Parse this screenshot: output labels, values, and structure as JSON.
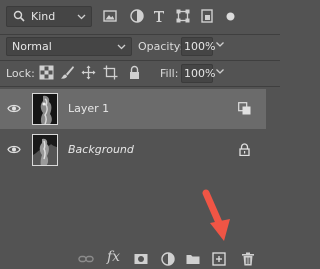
{
  "filter": {
    "kind_label": "Kind",
    "icons": [
      "image-filter-icon",
      "adjustment-filter-icon",
      "type-filter-icon",
      "shape-filter-icon",
      "smart-object-filter-icon",
      "filter-toggle-icon"
    ]
  },
  "blend": {
    "mode": "Normal",
    "opacity_label": "Opacity:",
    "opacity_value": "100%"
  },
  "lock": {
    "label": "Lock:",
    "fill_label": "Fill:",
    "fill_value": "100%"
  },
  "layers": [
    {
      "name": "Layer 1",
      "visible": true,
      "selected": true,
      "italic": false,
      "badge": "smart-object-icon"
    },
    {
      "name": "Background",
      "visible": true,
      "selected": false,
      "italic": true,
      "badge": "lock-icon"
    }
  ],
  "bottom_bar": {
    "fx_label": "fx",
    "icons": [
      "link-layers-icon",
      "fx-icon",
      "add-mask-icon",
      "adjustment-layer-icon",
      "new-group-icon",
      "new-layer-icon",
      "delete-layer-icon"
    ]
  },
  "colors": {
    "panel_bg": "#535353",
    "selected_row": "#6b6b6b",
    "arrow": "#f05545"
  }
}
